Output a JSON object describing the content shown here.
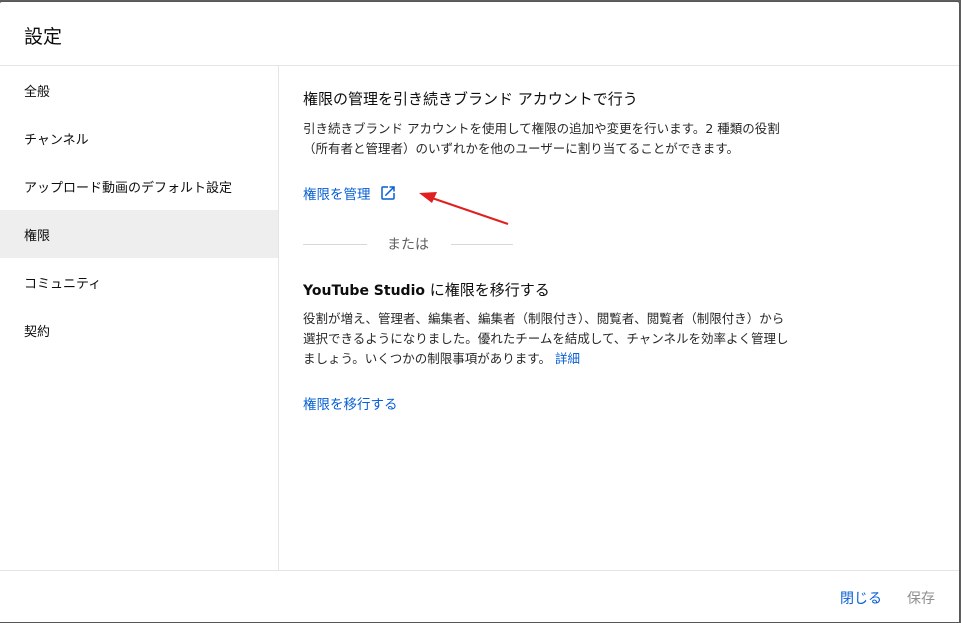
{
  "dialog": {
    "title": "設定"
  },
  "sidebar": {
    "items": [
      {
        "label": "全般",
        "active": false
      },
      {
        "label": "チャンネル",
        "active": false
      },
      {
        "label": "アップロード動画のデフォルト設定",
        "active": false
      },
      {
        "label": "権限",
        "active": true
      },
      {
        "label": "コミュニティ",
        "active": false
      },
      {
        "label": "契約",
        "active": false
      }
    ]
  },
  "main": {
    "brand_section": {
      "title": "権限の管理を引き続きブランド アカウントで行う",
      "description_line1": "引き続きブランド アカウントを使用して権限の追加や変更を行います。2 種類の役割",
      "description_line2": "（所有者と管理者）のいずれかを他のユーザーに割り当てることができます。",
      "manage_link": "権限を管理",
      "manage_link_icon": "open-in-new-icon"
    },
    "divider_text": "または",
    "studio_section": {
      "title_bold": "YouTube Studio",
      "title_rest": " に権限を移行する",
      "description_line1": "役割が増え、管理者、編集者、編集者（制限付き）、閲覧者、閲覧者（制限付き）から",
      "description_line2": "選択できるようになりました。優れたチームを結成して、チャンネルを効率よく管理し",
      "description_line3": "ましょう。いくつかの制限事項があります。",
      "details_link": "詳細",
      "migrate_link": "権限を移行する"
    }
  },
  "footer": {
    "close_label": "閉じる",
    "save_label": "保存"
  },
  "colors": {
    "link": "#065fd4",
    "active_nav_bg": "#eeeeee",
    "annotation_arrow": "#e02020",
    "disabled_text": "#909090"
  }
}
